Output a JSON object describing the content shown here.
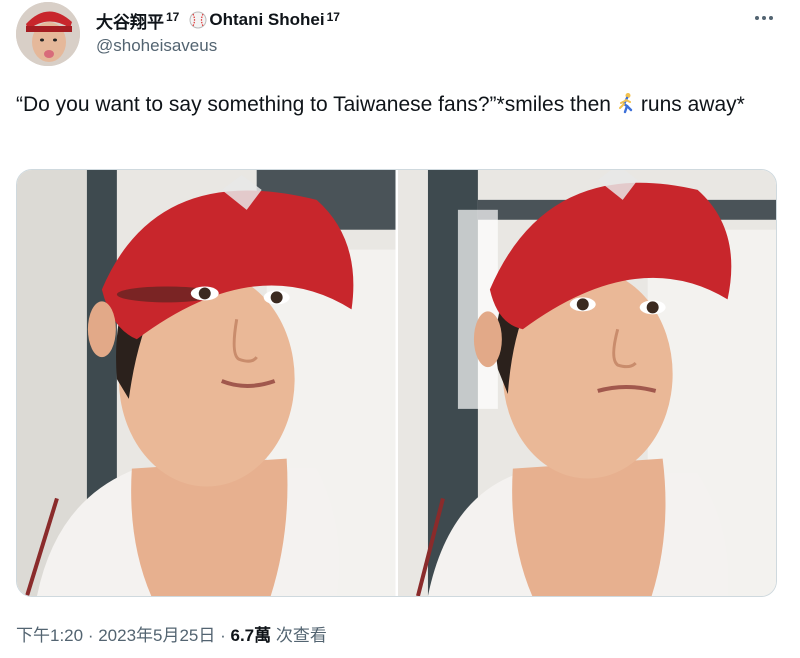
{
  "tweet": {
    "display_name": "大谷翔平",
    "badge_before_emoji": "17",
    "name_suffix": "Ohtani Shohei",
    "badge_after_name": "17",
    "handle": "@shoheisaveus",
    "text_part1": "“Do you want to say something to Taiwanese fans?”*smiles then",
    "text_part2": "runs away*",
    "time": "下午1:20",
    "separator": " · ",
    "date": "2023年5月25日",
    "views_count": "6.7萬",
    "views_label": " 次查看"
  },
  "icons": {
    "more": "more-horizontal-icon",
    "baseball": "baseball-emoji-icon",
    "runner": "person-running-emoji-icon"
  },
  "colors": {
    "text_primary": "#0f1419",
    "text_secondary": "#536471",
    "border": "#cfd9de",
    "cap_red": "#c8262c"
  }
}
